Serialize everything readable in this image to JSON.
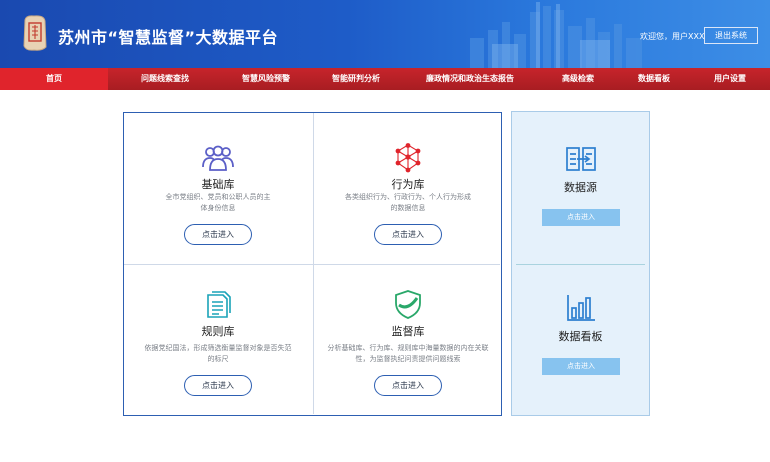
{
  "header": {
    "title": "苏州市“智慧监督”大数据平台",
    "welcome": "欢迎您，用户XXX",
    "logout_label": "退出系统"
  },
  "nav": {
    "items": [
      {
        "label": "首页",
        "active": true
      },
      {
        "label": "问题线索查找"
      },
      {
        "label": "智慧风险预警"
      },
      {
        "label": "智能研判分析"
      },
      {
        "label": "廉政情况和政治生态报告"
      },
      {
        "label": "高级检索"
      },
      {
        "label": "数据看板"
      },
      {
        "label": "用户设置"
      }
    ]
  },
  "modules": [
    {
      "title": "基础库",
      "desc": "全市党组织、党员和公职人员的主体身份信息",
      "button": "点击进入",
      "icon": "people-group-icon",
      "color": "#5b5fc7"
    },
    {
      "title": "行为库",
      "desc": "各类组织行为、行政行为、个人行为形成的数据信息",
      "button": "点击进入",
      "icon": "network-nodes-icon",
      "color": "#e0242c"
    },
    {
      "title": "规则库",
      "desc": "依据党纪国法，形成筛选衡量监督对象是否失范的标尺",
      "button": "点击进入",
      "icon": "document-stack-icon",
      "color": "#1aa3b8"
    },
    {
      "title": "监督库",
      "desc": "分析基础库、行为库、规则库中海量数据的内在关联性，为监督执纪问责提供问题线索",
      "button": "点击进入",
      "icon": "shield-check-icon",
      "color": "#2aa86a"
    }
  ],
  "side": [
    {
      "title": "数据源",
      "button": "点击进入",
      "icon": "data-source-icon",
      "color": "#2d7fd0"
    },
    {
      "title": "数据看板",
      "button": "点击进入",
      "icon": "bar-chart-icon",
      "color": "#2d7fd0"
    }
  ]
}
